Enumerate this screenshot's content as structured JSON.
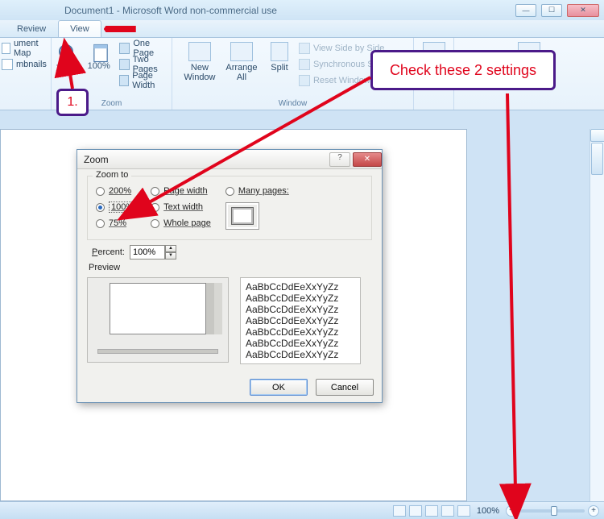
{
  "window": {
    "title": "Document1 - Microsoft Word non-commercial use"
  },
  "tabs": {
    "review": "Review",
    "view": "View"
  },
  "ribbon": {
    "left": {
      "docmap": "ument Map",
      "thumbs": "mbnails"
    },
    "zoomGroup": {
      "zoom": "Zoom",
      "hundred": "100%",
      "onepage": "One Page",
      "twopages": "Two Pages",
      "pagewidth": "Page Width",
      "label": "Zoom"
    },
    "windowGroup": {
      "new": "New Window",
      "arrange": "Arrange All",
      "split": "Split",
      "sbs": "View Side by Side",
      "sync": "Synchronous Scrolling",
      "reset": "Reset Window Position",
      "label": "Window"
    }
  },
  "dialog": {
    "title": "Zoom",
    "legend": "Zoom to",
    "r200": "200%",
    "r100": "100%",
    "r75": "75%",
    "pagewidth": "Page width",
    "textwidth": "Text width",
    "wholepage": "Whole page",
    "manypages": "Many pages:",
    "percentLabel": "Percent:",
    "percentValue": "100%",
    "previewLabel": "Preview",
    "sampleLine": "AaBbCcDdEeXxYyZz",
    "ok": "OK",
    "cancel": "Cancel"
  },
  "status": {
    "zoom": "100%"
  },
  "annotations": {
    "one": "1.",
    "check": "Check these 2 settings"
  }
}
